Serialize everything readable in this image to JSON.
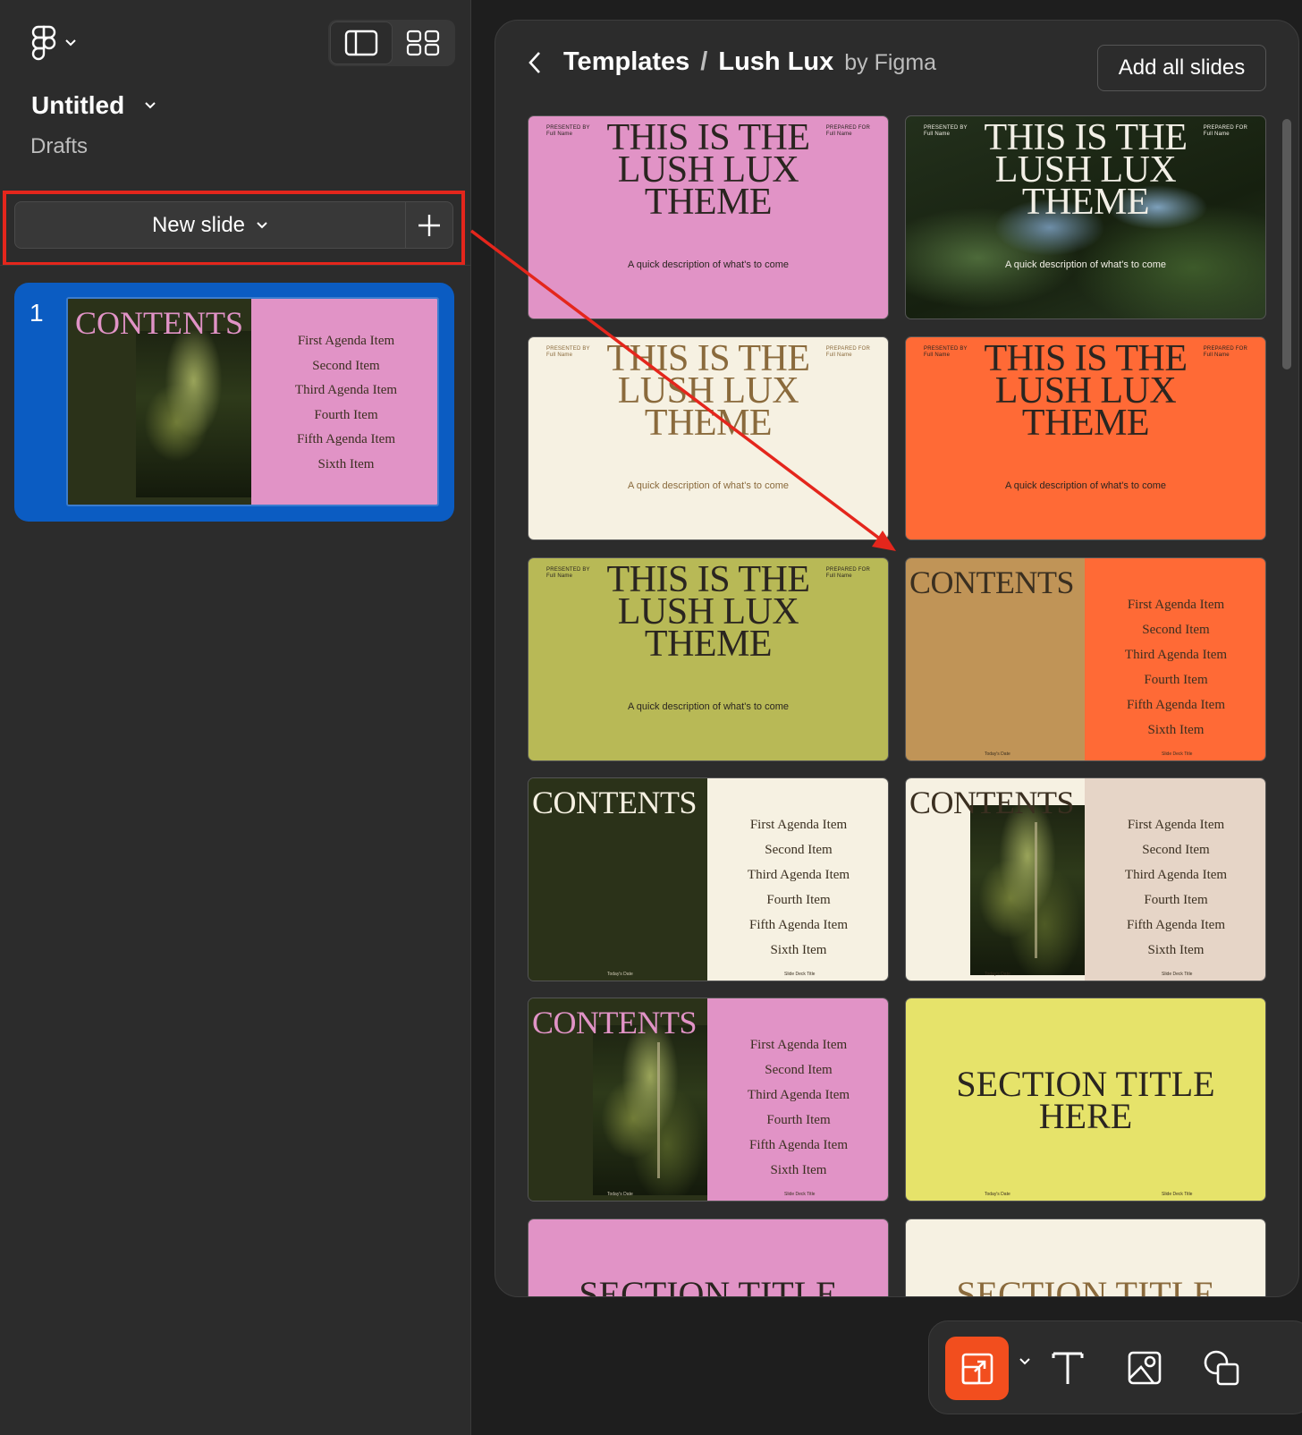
{
  "sidebar": {
    "file_title": "Untitled",
    "file_location": "Drafts",
    "new_slide_label": "New slide",
    "slide_number": "1"
  },
  "panel": {
    "breadcrumb_root": "Templates",
    "breadcrumb_sep": "/",
    "breadcrumb_current": "Lush Lux",
    "by_label": "by Figma",
    "add_all_label": "Add all slides"
  },
  "template_text": {
    "presented_by": "PRESENTED BY",
    "presented_name": "Full Name",
    "prepared_for": "PREPARED FOR",
    "prepared_name": "Full Name",
    "cover_title_lines": [
      "THIS IS THE",
      "LUSH LUX",
      "THEME"
    ],
    "cover_desc": "A quick description of what's to come",
    "contents_title": "CONTENTS",
    "agenda_items": [
      "First Agenda Item",
      "Second Item",
      "Third Agenda Item",
      "Fourth Item",
      "Fifth Agenda Item",
      "Sixth Item"
    ],
    "footer_date": "Today's Date",
    "footer_title": "Slide Deck Title",
    "section_lines": [
      "SECTION TITLE",
      "HERE"
    ],
    "section_partial": "SECTION TITLE"
  },
  "templates": [
    {
      "kind": "cover",
      "bg": "#e193c6",
      "photo": false
    },
    {
      "kind": "cover",
      "bg": "#1f2a1a",
      "photo": true
    },
    {
      "kind": "cover",
      "bg": "#f6f1e2",
      "photo": false,
      "text_color": "#8a6a3c"
    },
    {
      "kind": "cover",
      "bg": "#ff6a36",
      "photo": false
    },
    {
      "kind": "cover",
      "bg": "#b8b956",
      "photo": false
    },
    {
      "kind": "contents",
      "left_bg": "#c09457",
      "right_bg": "#ff6a36",
      "photo": false
    },
    {
      "kind": "contents",
      "left_bg": "#2b3219",
      "right_bg": "#f6f1e2",
      "photo": false,
      "title_color": "#f6f1e2"
    },
    {
      "kind": "contents",
      "left_bg": "#f6f1e2",
      "right_bg": "#e6d5c7",
      "photo": true
    },
    {
      "kind": "contents",
      "left_bg": "#2b3219",
      "right_bg": "#e193c6",
      "photo": true,
      "title_color": "#e193c6"
    },
    {
      "kind": "section",
      "bg": "#e6e36a"
    },
    {
      "kind": "section-partial",
      "bg": "#e193c6"
    },
    {
      "kind": "section-partial",
      "bg": "#f6f1e2"
    }
  ],
  "colors": {
    "accent_orange": "#f24e1e",
    "selection_blue": "#0b5cc2",
    "annotation_red": "#e4261c"
  },
  "icons": {
    "logo": "figma-logo-icon",
    "single_view": "sidebar-view-icon",
    "grid_view": "grid-view-icon",
    "back": "chevron-left-icon",
    "plus": "plus-icon",
    "tool_slide": "slide-tool-icon",
    "tool_text": "text-tool-icon",
    "tool_image": "image-tool-icon",
    "tool_shape": "shape-tool-icon"
  }
}
